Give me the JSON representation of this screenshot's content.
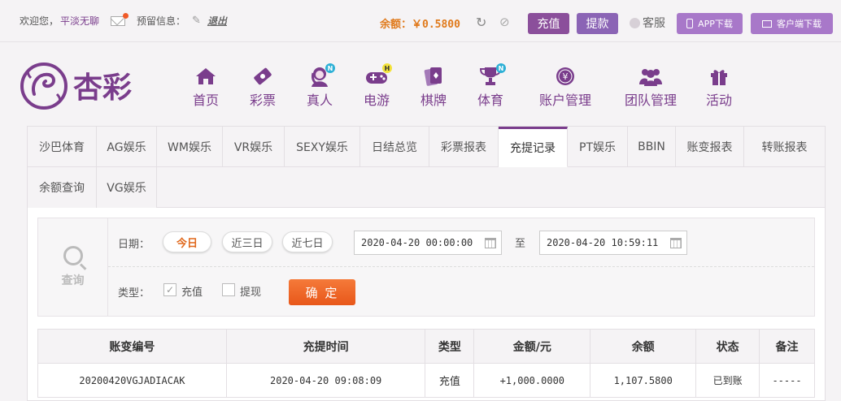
{
  "topbar": {
    "welcome": "欢迎您，",
    "username": "平淡无聊",
    "message_label": "预留信息：",
    "logout": "退出",
    "balance": "余额：￥0.5800",
    "charge_btn": "充值",
    "withdraw_btn": "提款",
    "service": "客服",
    "app_download": "APP下载",
    "client_download": "客户端下载"
  },
  "logo": {
    "text": "杏彩",
    "color": "#7a3d8c"
  },
  "nav": [
    {
      "label": "首页",
      "icon": "home-icon"
    },
    {
      "label": "彩票",
      "icon": "lottery-icon"
    },
    {
      "label": "真人",
      "icon": "live-dealer-icon",
      "badge": "N"
    },
    {
      "label": "电游",
      "icon": "gamepad-icon",
      "badge": "H"
    },
    {
      "label": "棋牌",
      "icon": "cards-icon"
    },
    {
      "label": "体育",
      "icon": "trophy-icon",
      "badge": "N"
    },
    {
      "label": "账户管理",
      "icon": "yen-coin-icon"
    },
    {
      "label": "团队管理",
      "icon": "team-icon"
    },
    {
      "label": "活动",
      "icon": "gift-icon"
    }
  ],
  "tabs": [
    "沙巴体育",
    "AG娱乐",
    "WM娱乐",
    "VR娱乐",
    "SEXY娱乐",
    "日结总览",
    "彩票报表",
    "充提记录",
    "PT娱乐",
    "BBIN",
    "账变报表",
    "转账报表",
    "余额查询",
    "VG娱乐"
  ],
  "query": {
    "label": "查询",
    "date_label": "日期：",
    "today": "今日",
    "last3": "近三日",
    "last7": "近七日",
    "start": "2020-04-20 00:00:00",
    "to": "至",
    "end": "2020-04-20 10:59:11",
    "type_label": "类型：",
    "deposit": "充值",
    "withdraw": "提现",
    "confirm": "确 定"
  },
  "table": {
    "headers": [
      "账变编号",
      "充提时间",
      "类型",
      "金额/元",
      "余额",
      "状态",
      "备注"
    ],
    "rows": [
      {
        "id": "20200420VGJADIACAK",
        "time": "2020-04-20 09:08:09",
        "type": "充值",
        "amount": "+1,000.0000",
        "balance": "1,107.5800",
        "status": "已到账",
        "note": "-----"
      }
    ]
  },
  "colors": {
    "brand": "#7a3d8c",
    "accent_orange": "#f2641f",
    "status_ok": "#2ea02e",
    "amount": "#c0202a"
  }
}
